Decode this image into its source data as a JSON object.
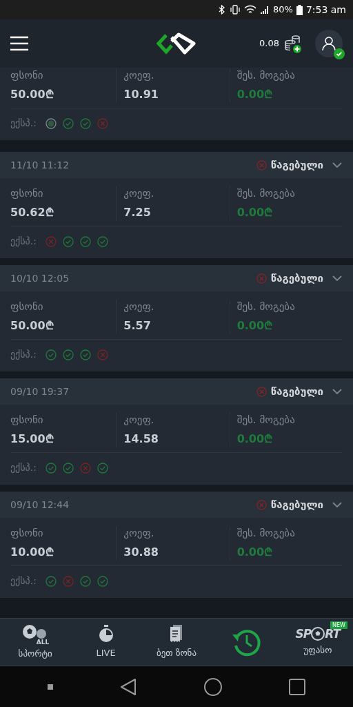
{
  "status_bar": {
    "battery": "80%",
    "time": "7:53 am"
  },
  "header": {
    "balance": "0.08"
  },
  "bets": [
    {
      "stake_label": "ფსონი",
      "stake": "50.00₾",
      "odds_label": "კოეფ.",
      "odds": "10.91",
      "win_label": "შეს. მოგება",
      "win": "0.00₾",
      "legs_label": "ექსპ.:",
      "legs": [
        {
          "kind": "pending"
        },
        {
          "kind": "won"
        },
        {
          "kind": "won"
        },
        {
          "kind": "lost"
        }
      ]
    },
    {
      "date": "11/10 11:12",
      "status": "წაგებული",
      "result": {
        "kind": "lost"
      },
      "stake_label": "ფსონი",
      "stake": "50.62₾",
      "odds_label": "კოეფ.",
      "odds": "7.25",
      "win_label": "შეს. მოგება",
      "win": "0.00₾",
      "legs_label": "ექსპ.:",
      "legs": [
        {
          "kind": "lost"
        },
        {
          "kind": "won"
        },
        {
          "kind": "won"
        },
        {
          "kind": "won"
        }
      ]
    },
    {
      "date": "10/10 12:05",
      "status": "წაგებული",
      "result": {
        "kind": "lost"
      },
      "stake_label": "ფსონი",
      "stake": "50.00₾",
      "odds_label": "კოეფ.",
      "odds": "5.57",
      "win_label": "შეს. მოგება",
      "win": "0.00₾",
      "legs_label": "ექსპ.:",
      "legs": [
        {
          "kind": "won"
        },
        {
          "kind": "won"
        },
        {
          "kind": "won"
        },
        {
          "kind": "lost"
        }
      ]
    },
    {
      "date": "09/10 19:37",
      "status": "წაგებული",
      "result": {
        "kind": "lost"
      },
      "stake_label": "ფსონი",
      "stake": "15.00₾",
      "odds_label": "კოეფ.",
      "odds": "14.58",
      "win_label": "შეს. მოგება",
      "win": "0.00₾",
      "legs_label": "ექსპ.:",
      "legs": [
        {
          "kind": "won"
        },
        {
          "kind": "won"
        },
        {
          "kind": "lost"
        },
        {
          "kind": "won"
        }
      ]
    },
    {
      "date": "09/10 12:44",
      "status": "წაგებული",
      "result": {
        "kind": "lost"
      },
      "stake_label": "ფსონი",
      "stake": "10.00₾",
      "odds_label": "კოეფ.",
      "odds": "30.88",
      "win_label": "შეს. მოგება",
      "win": "0.00₾",
      "legs_label": "ექსპ.:",
      "legs": [
        {
          "kind": "won"
        },
        {
          "kind": "lost"
        },
        {
          "kind": "won"
        },
        {
          "kind": "won"
        }
      ]
    }
  ],
  "bottom_nav": [
    {
      "kind": "sports",
      "label": "სპორტი",
      "badge": "ALL",
      "selected": false
    },
    {
      "kind": "live",
      "label": "LIVE",
      "selected": false
    },
    {
      "kind": "betzone",
      "label": "ბეთ ზონა",
      "selected": false
    },
    {
      "kind": "history",
      "selected": true
    },
    {
      "kind": "free",
      "label": "უფასო",
      "logo_left": "SP",
      "logo_right": "RT",
      "new_badge": "NEW",
      "selected": false
    }
  ]
}
